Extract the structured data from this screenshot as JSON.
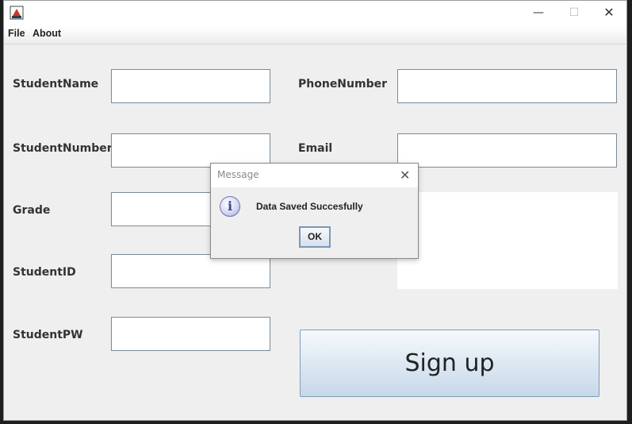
{
  "window": {
    "menu": [
      "File",
      "About"
    ],
    "controls": {
      "minimize": "—",
      "maximize": "☐",
      "close": "✕"
    }
  },
  "form": {
    "labels": {
      "student_name": "StudentName",
      "student_number": "StudentNumber",
      "grade": "Grade",
      "student_id": "StudentID",
      "student_pw": "StudentPW",
      "phone_number": "PhoneNumber",
      "email": "Email"
    },
    "values": {
      "student_name": "",
      "student_number": "",
      "grade": "",
      "student_id": "",
      "student_pw": "",
      "phone_number": "",
      "email": "",
      "notes": ""
    },
    "signup_label": "Sign up"
  },
  "dialog": {
    "title": "Message",
    "close": "✕",
    "icon": "info-icon",
    "info_glyph": "i",
    "message": "Data Saved Succesfully",
    "ok_label": "OK"
  }
}
